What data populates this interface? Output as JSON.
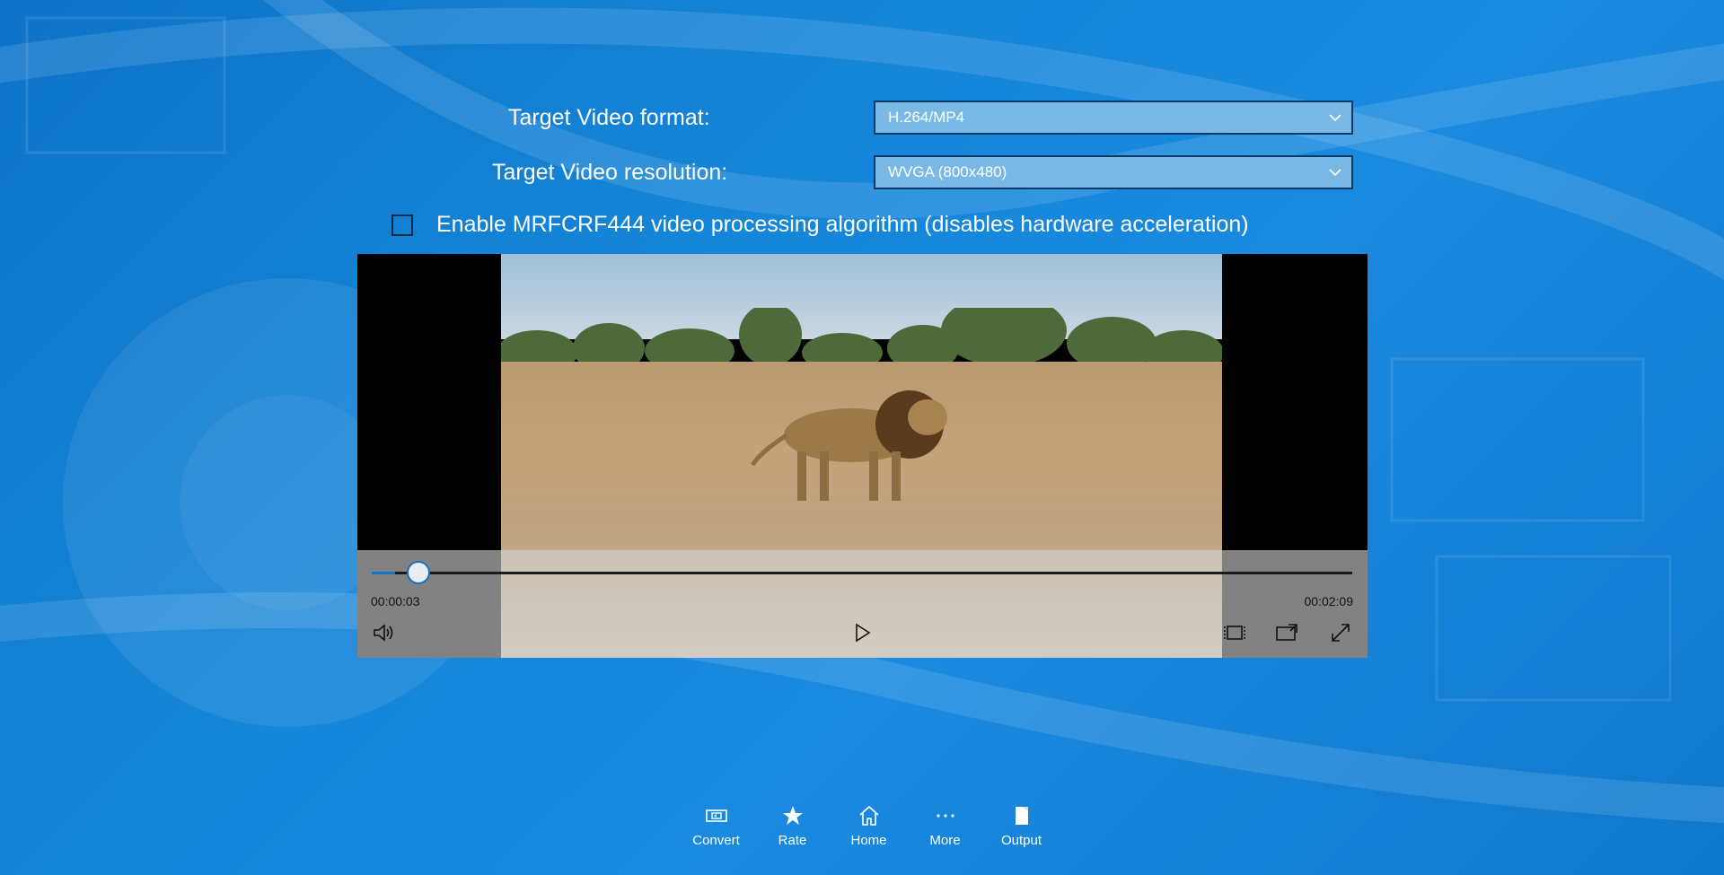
{
  "form": {
    "format_label": "Target Video format:",
    "format_value": "H.264/MP4",
    "resolution_label": "Target Video resolution:",
    "resolution_value": "WVGA (800x480)",
    "checkbox_label": "Enable MRFCRF444 video processing algorithm (disables hardware acceleration)",
    "checkbox_checked": false
  },
  "player": {
    "current_time": "00:00:03",
    "total_time": "00:02:09",
    "progress": 0.024,
    "accent": "#1573c4"
  },
  "bottom_bar": {
    "items": [
      {
        "label": "Convert",
        "icon": "convert-icon"
      },
      {
        "label": "Rate",
        "icon": "star-icon"
      },
      {
        "label": "Home",
        "icon": "home-icon"
      },
      {
        "label": "More",
        "icon": "more-icon"
      },
      {
        "label": "Output",
        "icon": "output-icon"
      }
    ]
  },
  "colors": {
    "background": "#1585d8",
    "dropdown_fill": "#7ab8e6"
  }
}
